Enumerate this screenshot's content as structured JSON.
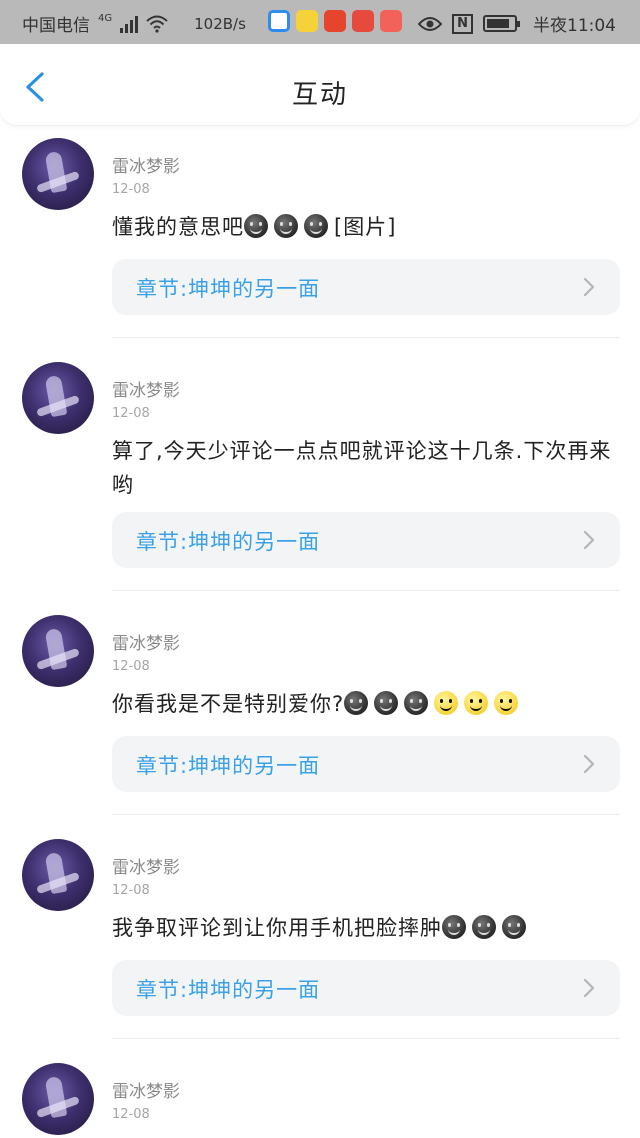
{
  "status_bar": {
    "carrier": "中国电信",
    "network": "4G",
    "speed": "102B/s",
    "time": "半夜11:04",
    "nfc_label": "N"
  },
  "header": {
    "title": "互动"
  },
  "comments": [
    {
      "username": "雷冰梦影",
      "date": "12-08",
      "text": "懂我的意思吧",
      "emojis": [
        "dark",
        "dark",
        "dark"
      ],
      "suffix": "[图片]",
      "chapter": "章节:坤坤的另一面"
    },
    {
      "username": "雷冰梦影",
      "date": "12-08",
      "text": "算了,今天少评论一点点吧就评论这十几条.下次再来哟",
      "emojis": [],
      "suffix": "",
      "chapter": "章节:坤坤的另一面"
    },
    {
      "username": "雷冰梦影",
      "date": "12-08",
      "text": "你看我是不是特别爱你?",
      "emojis": [
        "dark",
        "dark",
        "dark",
        "yellow",
        "yellow",
        "yellow"
      ],
      "suffix": "",
      "chapter": "章节:坤坤的另一面"
    },
    {
      "username": "雷冰梦影",
      "date": "12-08",
      "text": "我争取评论到让你用手机把脸摔肿",
      "emojis": [
        "dark",
        "dark",
        "dark"
      ],
      "suffix": "",
      "chapter": "章节:坤坤的另一面"
    },
    {
      "username": "雷冰梦影",
      "date": "12-08"
    }
  ],
  "colors": {
    "accent": "#3aa1e6",
    "status_bar": "#b9b9b9",
    "chapter_bg": "#f3f4f6"
  },
  "icons": {
    "back": "chevron-left-icon",
    "chapter_arrow": "chevron-right-icon"
  }
}
